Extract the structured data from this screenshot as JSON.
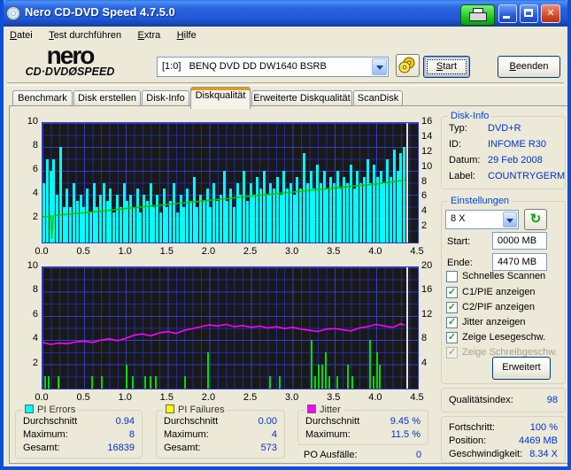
{
  "window": {
    "title": "Nero CD-DVD Speed 4.7.5.0"
  },
  "titlebar_buttons": {
    "printer": "print-screen",
    "minimize": "minimize",
    "maximize": "maximize",
    "close": "close"
  },
  "menu": {
    "items": [
      {
        "label": "Datei"
      },
      {
        "label": "Test durchführen"
      },
      {
        "label": "Extra"
      },
      {
        "label": "Hilfe"
      }
    ]
  },
  "toolbar": {
    "logo_line1": "nero",
    "logo_line2": "CD·DVDØSPEED",
    "drive": "[1:0]   BENQ DVD DD DW1640 BSRB",
    "eject_icon": "disc-eject",
    "start_label": "Start",
    "quit_label": "Beenden"
  },
  "tabs": [
    {
      "label": "Benchmark"
    },
    {
      "label": "Disk erstellen"
    },
    {
      "label": "Disk-Info"
    },
    {
      "label": "Diskqualität",
      "active": true
    },
    {
      "label": "Erweiterte Diskqualität"
    },
    {
      "label": "ScanDisk"
    }
  ],
  "disk_info": {
    "title": "Disk-Info",
    "rows": [
      {
        "label": "Typ:",
        "value": "DVD+R"
      },
      {
        "label": "ID:",
        "value": "INFOME R30"
      },
      {
        "label": "Datum:",
        "value": "29 Feb 2008"
      },
      {
        "label": "Label:",
        "value": "COUNTRYGERM"
      }
    ]
  },
  "settings": {
    "title": "Einstellungen",
    "speed_selected": "8 X",
    "refresh_icon": "refresh-arrows",
    "start_label": "Start:",
    "start_value": "0000 MB",
    "end_label": "Ende:",
    "end_value": "4470 MB",
    "checkboxes": [
      {
        "label": "Schnelles Scannen",
        "checked": false,
        "disabled": false
      },
      {
        "label": "C1/PIE anzeigen",
        "checked": true,
        "disabled": false
      },
      {
        "label": "C2/PIF anzeigen",
        "checked": true,
        "disabled": false
      },
      {
        "label": "Jitter anzeigen",
        "checked": true,
        "disabled": false
      },
      {
        "label": "Zeige Lesegeschw.",
        "checked": true,
        "disabled": false
      },
      {
        "label": "Zeige Schreibgeschw.",
        "checked": true,
        "disabled": true
      }
    ],
    "advanced_label": "Erweitert"
  },
  "quality": {
    "label": "Qualitätsindex:",
    "value": "98"
  },
  "progress": {
    "rows": [
      {
        "label": "Fortschritt:",
        "value": "100 %"
      },
      {
        "label": "Position:",
        "value": "4469 MB"
      },
      {
        "label": "Geschwindigkeit:",
        "value": "8.34 X"
      }
    ]
  },
  "stats": {
    "pi_errors": {
      "title": "PI Errors",
      "color": "#00ffff",
      "rows": [
        {
          "label": "Durchschnitt",
          "value": "0.94"
        },
        {
          "label": "Maximum:",
          "value": "8"
        },
        {
          "label": "Gesamt:",
          "value": "16839"
        }
      ]
    },
    "pi_failures": {
      "title": "PI Failures",
      "color": "#ffff00",
      "rows": [
        {
          "label": "Durchschnitt",
          "value": "0.00"
        },
        {
          "label": "Maximum:",
          "value": "4"
        },
        {
          "label": "Gesamt:",
          "value": "573"
        }
      ]
    },
    "jitter": {
      "title": "Jitter",
      "color": "#ff00ff",
      "rows": [
        {
          "label": "Durchschnitt",
          "value": "9.45 %"
        },
        {
          "label": "Maximum:",
          "value": "11.5 %"
        }
      ]
    },
    "po_failures": {
      "label": "PO Ausfälle:",
      "value": "0"
    }
  },
  "chart_data": [
    {
      "type": "bar",
      "name": "pi-errors-vs-position",
      "x_label": "position (GB)",
      "x_max": 4.5,
      "left_max": 10,
      "right_max": 16,
      "left_ticks": [
        10,
        8,
        6,
        4,
        2
      ],
      "right_ticks": [
        16,
        14,
        12,
        10,
        8,
        6,
        4,
        2
      ],
      "x_ticks": [
        "0.0",
        "0.5",
        "1.0",
        "1.5",
        "2.0",
        "2.5",
        "3.0",
        "3.5",
        "4.0",
        "4.5"
      ],
      "bars": {
        "name": "pie-bar",
        "color": "#00ffff",
        "axis": "left",
        "width": 3,
        "step": 0.04,
        "heights": [
          5,
          7,
          6,
          7,
          4,
          8,
          3,
          4.5,
          3,
          5,
          3.5,
          4,
          3,
          4.5,
          2.5,
          5,
          3,
          4,
          5,
          3.5,
          4.5,
          2.5,
          4,
          3,
          5,
          3.5,
          4,
          3,
          4.5,
          2.5,
          4,
          3.5,
          5,
          3,
          4,
          2.5,
          4.5,
          3,
          3.5,
          5,
          2.5,
          4,
          3,
          4.5,
          3.5,
          5.5,
          3,
          4,
          3.5,
          4.5,
          3,
          5,
          3.5,
          4,
          6,
          3.5,
          4.5,
          3,
          5,
          4,
          6,
          3.5,
          5,
          4,
          5.5,
          4.5,
          6,
          4,
          5,
          4.5,
          5.5,
          4,
          6,
          4.5,
          5,
          4,
          5.5,
          4.5,
          7.5,
          5,
          6,
          4.5,
          6.5,
          5,
          6,
          4.5,
          5.5,
          5,
          6,
          4.5,
          5.5,
          5,
          6.5,
          4.5,
          6,
          5,
          5.5,
          7,
          5,
          6.5,
          5.5,
          6,
          5,
          7,
          5.5,
          7.8,
          6,
          7.5,
          8
        ]
      },
      "line": {
        "name": "read-speed-line",
        "color": "#00cc00",
        "axis": "right",
        "unit": "X",
        "points": [
          [
            0,
            3.4
          ],
          [
            0.1,
            3.55
          ],
          [
            0.11,
            0.5
          ],
          [
            0.13,
            3.6
          ],
          [
            0.5,
            4.0
          ],
          [
            1.0,
            4.55
          ],
          [
            1.5,
            5.1
          ],
          [
            2.0,
            5.65
          ],
          [
            2.5,
            6.2
          ],
          [
            3.0,
            6.75
          ],
          [
            3.5,
            7.3
          ],
          [
            4.0,
            7.85
          ],
          [
            4.34,
            8.34
          ]
        ]
      },
      "end_marker": 4.36
    },
    {
      "type": "bar",
      "name": "jitter-and-pi-failures-vs-position",
      "x_label": "position (GB)",
      "x_max": 4.5,
      "left_max": 10,
      "right_max": 20,
      "left_ticks": [
        10,
        8,
        6,
        4,
        2
      ],
      "right_ticks": [
        20,
        16,
        12,
        8,
        4
      ],
      "x_ticks": [
        "0.0",
        "0.5",
        "1.0",
        "1.5",
        "2.0",
        "2.5",
        "3.0",
        "3.5",
        "4.0",
        "4.5"
      ],
      "bars": {
        "name": "pif-bar",
        "color": "#00dd00",
        "axis": "left",
        "width": 2,
        "points": [
          [
            0.02,
            1
          ],
          [
            0.06,
            1
          ],
          [
            0.18,
            1
          ],
          [
            0.58,
            1
          ],
          [
            0.7,
            1
          ],
          [
            1.0,
            2
          ],
          [
            1.07,
            1
          ],
          [
            1.22,
            1
          ],
          [
            1.28,
            1
          ],
          [
            1.35,
            1
          ],
          [
            1.7,
            1
          ],
          [
            1.97,
            3
          ],
          [
            2.72,
            1
          ],
          [
            2.83,
            1
          ],
          [
            3.21,
            4
          ],
          [
            3.26,
            1
          ],
          [
            3.3,
            2
          ],
          [
            3.34,
            2
          ],
          [
            3.38,
            3
          ],
          [
            3.43,
            1
          ],
          [
            3.52,
            1
          ],
          [
            3.65,
            2
          ],
          [
            3.7,
            1
          ],
          [
            3.92,
            4
          ],
          [
            3.96,
            1
          ],
          [
            4.0,
            3
          ],
          [
            4.03,
            2
          ]
        ]
      },
      "line": {
        "name": "jitter-line",
        "color": "#ff00ff",
        "axis": "right",
        "unit": "%",
        "points": [
          [
            0,
            7.6
          ],
          [
            0.1,
            7.3
          ],
          [
            0.2,
            7.5
          ],
          [
            0.3,
            7.4
          ],
          [
            0.4,
            7.7
          ],
          [
            0.5,
            7.8
          ],
          [
            0.6,
            7.6
          ],
          [
            0.7,
            8.0
          ],
          [
            0.8,
            8.2
          ],
          [
            0.9,
            7.9
          ],
          [
            1.0,
            8.3
          ],
          [
            1.1,
            8.8
          ],
          [
            1.2,
            9.0
          ],
          [
            1.3,
            8.7
          ],
          [
            1.4,
            9.2
          ],
          [
            1.5,
            9.4
          ],
          [
            1.6,
            9.1
          ],
          [
            1.7,
            9.6
          ],
          [
            1.8,
            9.9
          ],
          [
            1.9,
            10.2
          ],
          [
            2.0,
            10.5
          ],
          [
            2.1,
            10.3
          ],
          [
            2.2,
            10.6
          ],
          [
            2.3,
            10.2
          ],
          [
            2.4,
            10.4
          ],
          [
            2.5,
            10.1
          ],
          [
            2.6,
            10.3
          ],
          [
            2.7,
            10.0
          ],
          [
            2.8,
            10.2
          ],
          [
            2.9,
            9.9
          ],
          [
            3.0,
            10.1
          ],
          [
            3.1,
            9.8
          ],
          [
            3.2,
            9.6
          ],
          [
            3.3,
            9.4
          ],
          [
            3.4,
            9.8
          ],
          [
            3.5,
            9.9
          ],
          [
            3.6,
            9.7
          ],
          [
            3.7,
            9.5
          ],
          [
            3.8,
            10.0
          ],
          [
            3.9,
            10.2
          ],
          [
            4.0,
            10.6
          ],
          [
            4.1,
            10.3
          ],
          [
            4.2,
            10.1
          ],
          [
            4.3,
            10.7
          ],
          [
            4.34,
            10.4
          ]
        ]
      },
      "end_marker": 4.36
    }
  ]
}
